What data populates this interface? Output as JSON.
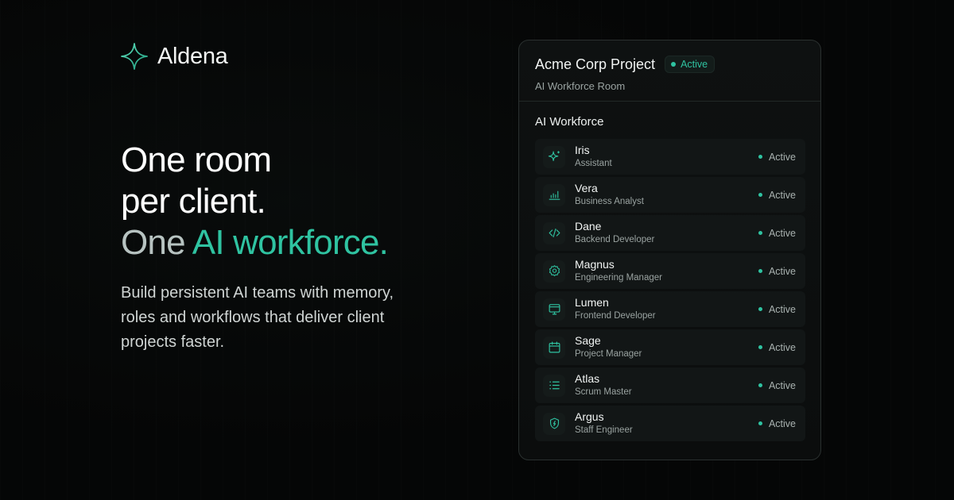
{
  "brand": {
    "name": "Aldena",
    "logo_icon": "sparkle-icon"
  },
  "hero": {
    "line1": "One room",
    "line2": "per client.",
    "line3_prefix": "One ",
    "line3_accent": "AI workforce.",
    "subtitle": "Build persistent AI teams with memory, roles and workflows that deliver client projects faster."
  },
  "colors": {
    "accent": "#2fc3a1",
    "background": "#050606",
    "card": "#0e1111",
    "row": "#121616"
  },
  "card": {
    "title": "Acme Corp Project",
    "badge": "Active",
    "subtitle": "AI Workforce Room",
    "section_title": "AI Workforce",
    "members": [
      {
        "name": "Iris",
        "role": "Assistant",
        "status": "Active",
        "icon": "sparkle-icon"
      },
      {
        "name": "Vera",
        "role": "Business Analyst",
        "status": "Active",
        "icon": "bar-chart-icon"
      },
      {
        "name": "Dane",
        "role": "Backend Developer",
        "status": "Active",
        "icon": "code-icon"
      },
      {
        "name": "Magnus",
        "role": "Engineering Manager",
        "status": "Active",
        "icon": "gear-icon"
      },
      {
        "name": "Lumen",
        "role": "Frontend Developer",
        "status": "Active",
        "icon": "monitor-icon"
      },
      {
        "name": "Sage",
        "role": "Project Manager",
        "status": "Active",
        "icon": "calendar-icon"
      },
      {
        "name": "Atlas",
        "role": "Scrum Master",
        "status": "Active",
        "icon": "list-icon"
      },
      {
        "name": "Argus",
        "role": "Staff Engineer",
        "status": "Active",
        "icon": "shield-icon"
      }
    ]
  }
}
